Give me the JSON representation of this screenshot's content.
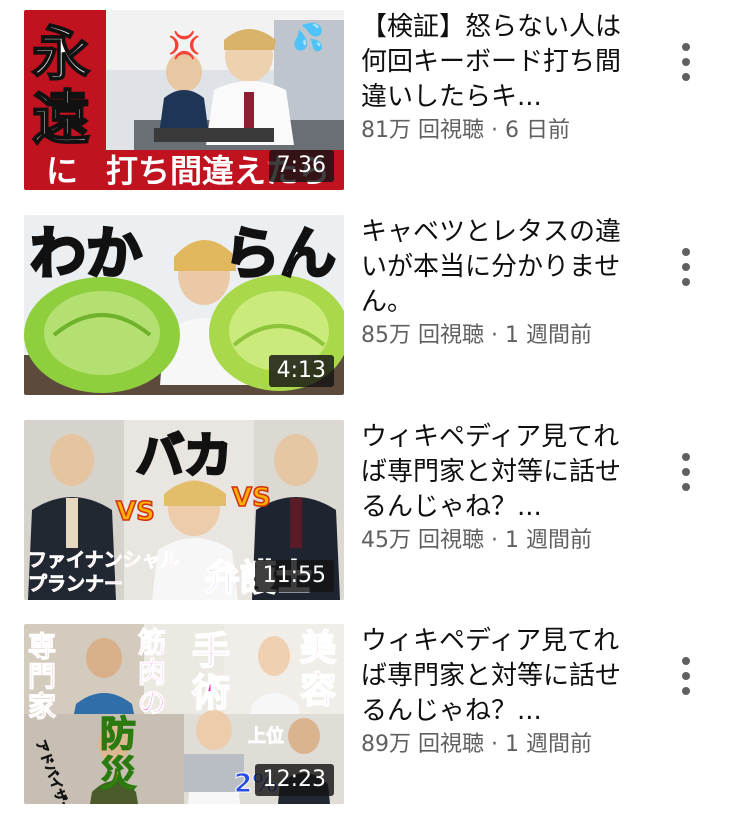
{
  "videos": [
    {
      "title": "【検証】怒らない人は何回キーボード打ち間違いしたらキ...",
      "meta": "81万 回視聴 · 6 日前",
      "duration": "7:36",
      "thumb_text": [
        "永",
        "遠",
        "に",
        "打ち間違えたら"
      ]
    },
    {
      "title": "キャベツとレタスの違いが本当に分かりません。",
      "meta": "85万 回視聴 · 1 週間前",
      "duration": "4:13",
      "thumb_text": [
        "わか",
        "らん"
      ]
    },
    {
      "title": "ウィキペディア見てれば専門家と対等に話せるんじゃね？...",
      "meta": "45万 回視聴 · 1 週間前",
      "duration": "11:55",
      "thumb_text": [
        "バカ",
        "VS",
        "VS",
        "ファイナンシャル",
        "プランナー",
        "弁護士"
      ]
    },
    {
      "title": "ウィキペディア見てれば専門家と対等に話せるんじゃね？...",
      "meta": "89万 回視聴 · 1 週間前",
      "duration": "12:23",
      "thumb_text": [
        "専",
        "門",
        "家",
        "筋",
        "肉",
        "の",
        "手",
        "術",
        "美",
        "容",
        "防",
        "災",
        "アドバイザー",
        "上位",
        "2%"
      ]
    }
  ],
  "icons": {
    "more": "more-vertical-icon"
  }
}
